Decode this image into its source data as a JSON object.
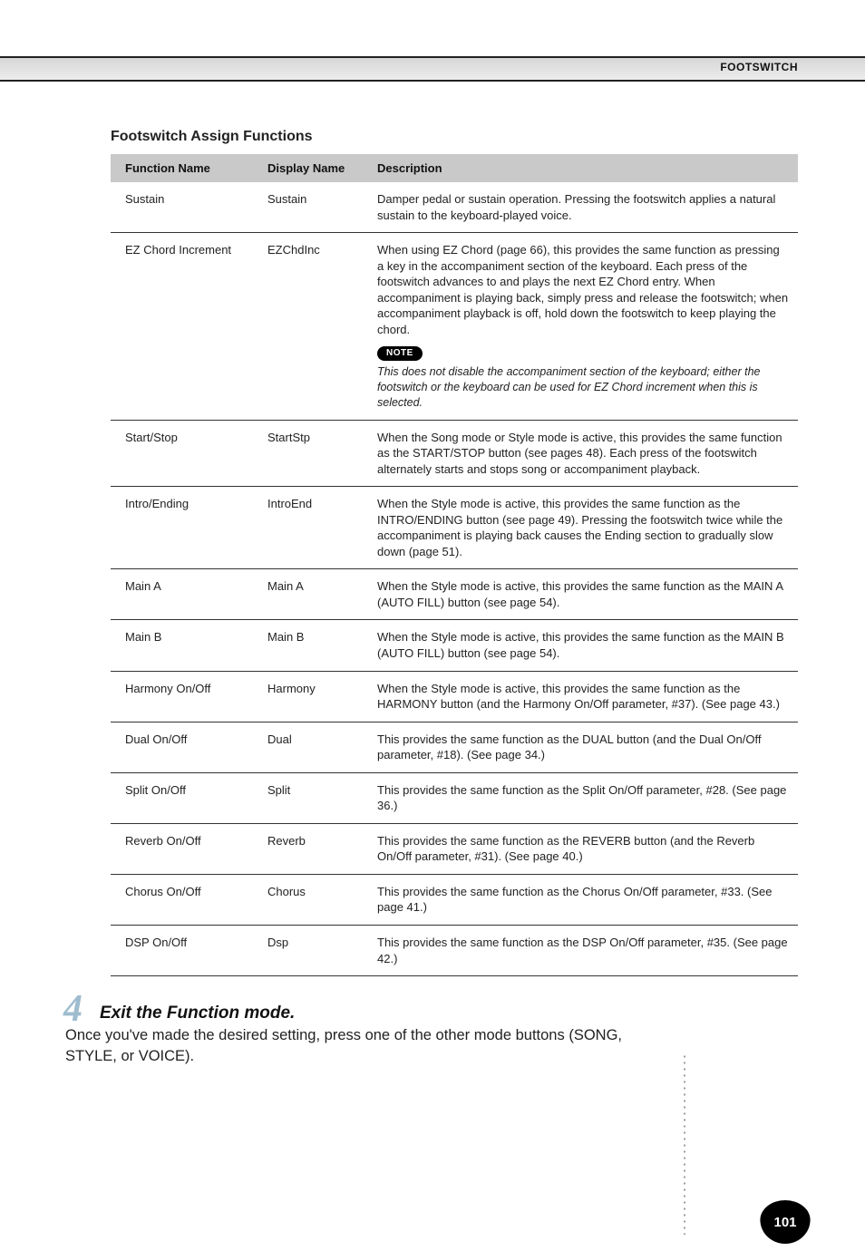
{
  "header": {
    "section": "FOOTSWITCH"
  },
  "section": {
    "title": "Footswitch Assign Functions"
  },
  "table": {
    "headers": {
      "func": "Function Name",
      "disp": "Display Name",
      "desc": "Description"
    },
    "rows": [
      {
        "func": "Sustain",
        "disp": "Sustain",
        "desc": "Damper pedal or sustain operation.  Pressing the footswitch applies a natural sustain to the keyboard-played voice."
      },
      {
        "func": "EZ Chord Increment",
        "disp": "EZChdInc",
        "desc": "When using EZ Chord (page 66), this provides the same function as pressing a key in the accompaniment section of the keyboard.  Each press of the footswitch advances to and plays the next EZ Chord entry.  When accompaniment is playing back, simply press and release the footswitch; when accompaniment playback is off, hold down the footswitch to keep playing the chord.",
        "note_label": "NOTE",
        "note": "This does not disable the accompaniment section of the keyboard; either the footswitch or the keyboard can be used for EZ Chord increment when this is selected."
      },
      {
        "func": "Start/Stop",
        "disp": "StartStp",
        "desc": "When the Song mode or Style mode is active, this provides the same function as the START/STOP button (see pages 48).  Each press of the footswitch alternately starts and stops song or accompaniment playback."
      },
      {
        "func": "Intro/Ending",
        "disp": "IntroEnd",
        "desc": "When the Style mode is active, this provides the same function as the INTRO/ENDING button (see page 49).  Pressing the footswitch twice while the accompaniment is playing back causes the Ending section to gradually slow down (page 51)."
      },
      {
        "func": "Main A",
        "disp": "Main A",
        "desc": "When the Style mode is active, this provides the same function as the MAIN A (AUTO FILL) button (see page 54)."
      },
      {
        "func": "Main B",
        "disp": "Main B",
        "desc": "When the Style mode is active, this provides the same function as the MAIN B (AUTO FILL) button (see page 54)."
      },
      {
        "func": "Harmony On/Off",
        "disp": "Harmony",
        "desc": "When the Style mode is active, this provides the same function as the HARMONY button (and the Harmony On/Off parameter, #37).  (See page 43.)"
      },
      {
        "func": "Dual On/Off",
        "disp": "Dual",
        "desc": "This provides the same function as the DUAL button (and the Dual On/Off parameter, #18).  (See page 34.)"
      },
      {
        "func": "Split On/Off",
        "disp": "Split",
        "desc": "This provides the same function as the Split On/Off parameter, #28.  (See page 36.)"
      },
      {
        "func": "Reverb On/Off",
        "disp": "Reverb",
        "desc": "This provides the same function as the REVERB button (and the Reverb On/Off parameter, #31).  (See page 40.)"
      },
      {
        "func": "Chorus On/Off",
        "disp": "Chorus",
        "desc": "This provides the same function as the Chorus On/Off parameter, #33.  (See page 41.)"
      },
      {
        "func": "DSP On/Off",
        "disp": "Dsp",
        "desc": "This provides the same function as the DSP On/Off parameter, #35.  (See page 42.)"
      }
    ]
  },
  "step": {
    "number": "4",
    "title": "Exit the Function mode.",
    "body": "Once you've made the desired setting, press one of the other mode buttons (SONG, STYLE, or VOICE)."
  },
  "footer": {
    "page": "101"
  }
}
